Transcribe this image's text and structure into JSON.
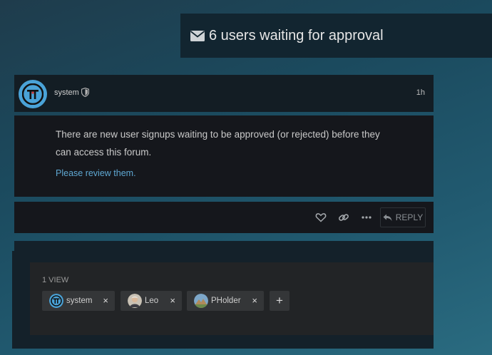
{
  "banner": {
    "title": "6 users waiting for approval",
    "icon": "envelope-icon"
  },
  "post": {
    "username": "system",
    "time": "1h",
    "body": "There are new user signups waiting to be approved (or rejected) before they can access this forum.",
    "link_text": "Please review them.",
    "reply_label": "REPLY"
  },
  "topic_map": {
    "views_label": "1 VIEW",
    "participants": [
      {
        "name": "system",
        "remove": "×"
      },
      {
        "name": "Leo",
        "remove": "×"
      },
      {
        "name": "PHolder",
        "remove": "×"
      }
    ],
    "add_label": "+"
  },
  "colors": {
    "accent": "#5fa8d3",
    "avatar_blue": "#4aa3d8",
    "bg_dark": "#15171c"
  }
}
